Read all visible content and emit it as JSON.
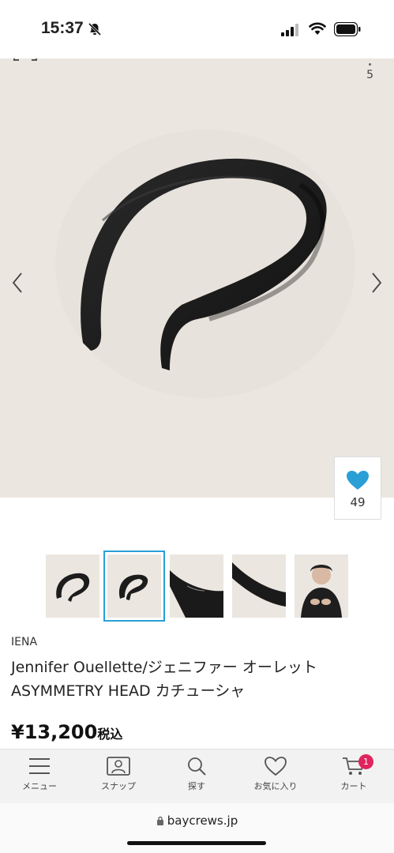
{
  "status": {
    "time": "15:37"
  },
  "hero": {
    "counter": "5",
    "favorite_count": "49"
  },
  "product": {
    "brand": "IENA",
    "title_line1": "Jennifer Ouellette/ジェニファー オーレット",
    "title_line2": "ASYMMETRY HEAD カチューシャ",
    "price": "¥13,200",
    "tax_label": "税込"
  },
  "nav": {
    "menu": "メニュー",
    "snap": "スナップ",
    "search": "探す",
    "favorites": "お気に入り",
    "cart": "カート",
    "cart_badge": "1"
  },
  "browser": {
    "url": "baycrews.jp"
  },
  "colors": {
    "accent": "#2a9fd6",
    "heart": "#2a9fd6",
    "badge": "#e0245e",
    "hero_bg": "#ebe6e0"
  }
}
